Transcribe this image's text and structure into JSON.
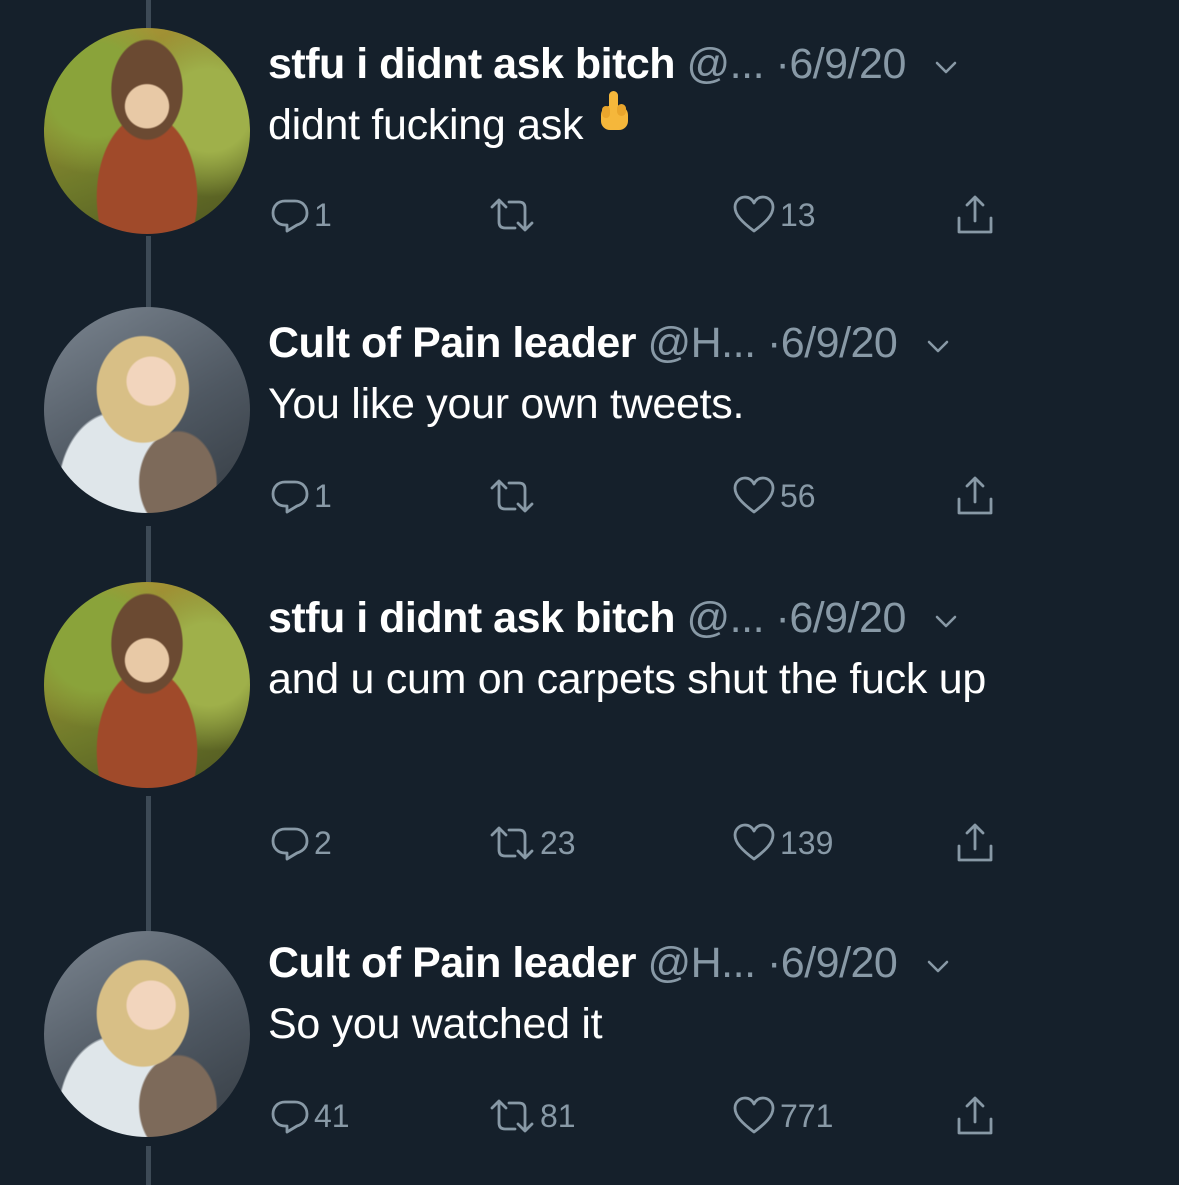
{
  "colors": {
    "background": "#15202b",
    "text": "#ffffff",
    "muted": "#8899a6",
    "thread_line": "#3d4a56"
  },
  "tweets": [
    {
      "display_name": "stfu i didnt ask bitch",
      "handle": "@...",
      "separator": "·",
      "date": "6/9/20",
      "text": "didnt fucking ask",
      "emoji": "middle-finger-emoji",
      "avatar": "avatar-1",
      "replies": "1",
      "retweets": "",
      "likes": "13"
    },
    {
      "display_name": "Cult of Pain leader",
      "handle": "@H...",
      "separator": "·",
      "date": "6/9/20",
      "text": "You like your own tweets.",
      "avatar": "avatar-2",
      "replies": "1",
      "retweets": "",
      "likes": "56"
    },
    {
      "display_name": "stfu i didnt ask bitch",
      "handle": "@...",
      "separator": "·",
      "date": "6/9/20",
      "text": "and u cum on carpets shut the fuck up",
      "avatar": "avatar-1",
      "replies": "2",
      "retweets": "23",
      "likes": "139"
    },
    {
      "display_name": "Cult of Pain leader",
      "handle": "@H...",
      "separator": "·",
      "date": "6/9/20",
      "text": "So you watched it",
      "avatar": "avatar-2",
      "replies": "41",
      "retweets": "81",
      "likes": "771"
    }
  ],
  "icons": {
    "reply": "reply-icon",
    "retweet": "retweet-icon",
    "like": "heart-icon",
    "share": "share-icon",
    "caret": "chevron-down-icon"
  }
}
